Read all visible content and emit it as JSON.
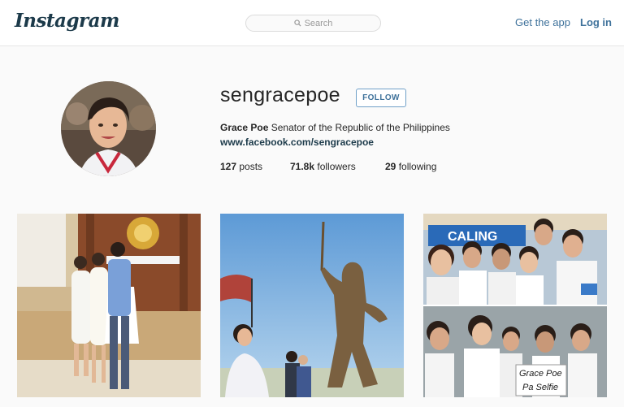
{
  "header": {
    "logo": "Instagram",
    "search_placeholder": "Search",
    "get_app": "Get the app",
    "login": "Log in"
  },
  "profile": {
    "username": "sengracepoe",
    "follow_label": "FOLLOW",
    "full_name": "Grace Poe",
    "bio": "Senator of the Republic of the Philippines",
    "website": "www.facebook.com/sengracepoe",
    "stats": {
      "posts_count": "127",
      "posts_label": "posts",
      "followers_count": "71.8k",
      "followers_label": "followers",
      "following_count": "29",
      "following_label": "following"
    }
  },
  "posts": {
    "photo3_sign_line1": "Grace Poe",
    "photo3_sign_line2": "Pa Selfie",
    "photo3_banner": "CALING"
  }
}
